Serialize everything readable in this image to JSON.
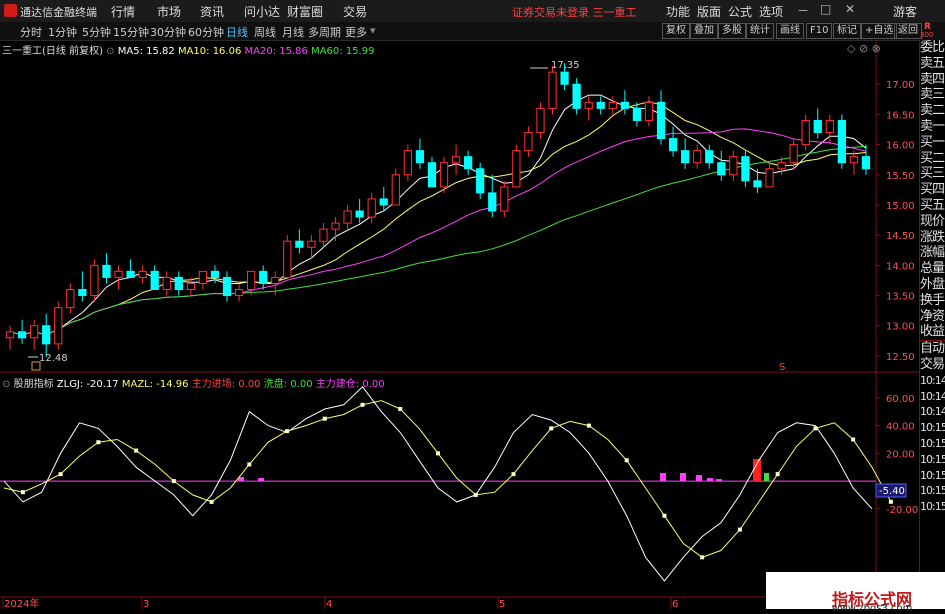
{
  "app": {
    "title": "通达信金融终端"
  },
  "menu": [
    "行情",
    "市场",
    "资讯",
    "问小达",
    "财富圈",
    "交易"
  ],
  "notice": "证券交易未登录  三一重工",
  "right_menu": [
    "功能",
    "版面",
    "公式",
    "选项"
  ],
  "user": "游客",
  "periods": [
    "分时",
    "1分钟",
    "5分钟",
    "15分钟",
    "30分钟",
    "60分钟",
    "日线",
    "周线",
    "月线",
    "多周期",
    "更多"
  ],
  "active_period": "日线",
  "toolbar_right": [
    "复权",
    "叠加",
    "多股",
    "统计",
    "画线",
    "F10",
    "标记",
    "+自选",
    "返回"
  ],
  "rank_label": "R",
  "rank_value": "300",
  "main_chart": {
    "stock_label": "三一重工(日线 前复权)",
    "ma5": "MA5: 15.82",
    "ma10": "MA10: 16.06",
    "ma20": "MA20: 15.86",
    "ma60": "MA60: 15.99",
    "high_label": "17.35",
    "low_label": "12.48",
    "y_ticks": [
      "17.00",
      "16.50",
      "16.00",
      "15.50",
      "15.00",
      "14.50",
      "14.00",
      "13.50",
      "13.00",
      "12.50"
    ],
    "s_marker": "S"
  },
  "indicator": {
    "name": "股朋指标",
    "zlgj": "ZLGJ: -20.17",
    "mazl": "MAZL: -14.96",
    "zljc": "主力进场: 0.00",
    "xp": "洗盘: 0.00",
    "zljc2": "主力建仓: 0.00",
    "y_ticks": [
      "60.00",
      "40.00",
      "20.00",
      "-20.00"
    ],
    "current_value": "-5.40"
  },
  "x_axis": [
    "2024年",
    "3",
    "4",
    "5",
    "6"
  ],
  "side_panel": [
    "委比",
    "卖五",
    "卖四",
    "卖三",
    "卖二",
    "卖一",
    "买一",
    "买二",
    "买三",
    "买四",
    "买五",
    "现价",
    "涨跌",
    "涨幅",
    "总量",
    "外盘",
    "换手",
    "净资",
    "收益",
    "自动",
    "交易",
    "10:14",
    "10:14",
    "10:14",
    "10:15",
    "10:15",
    "10:15",
    "10:15",
    "10:15",
    "10:15"
  ],
  "watermark": {
    "line1": "指标公式网",
    "line2": "www.zbgs3.com"
  },
  "colors": {
    "up": "#ff3030",
    "down": "#00ffff",
    "ma5": "#ffffff",
    "ma10": "#ffff66",
    "ma20": "#ff40ff",
    "ma60": "#40e040",
    "zero_line": "#ff40ff",
    "accent_red": "#ff4040"
  },
  "chart_data": {
    "type": "candlestick",
    "x_axis_labels": [
      "2024年",
      "3",
      "4",
      "5",
      "6"
    ],
    "candles_ohlc": [
      [
        12.8,
        13.0,
        12.6,
        12.9
      ],
      [
        12.9,
        13.1,
        12.7,
        12.8
      ],
      [
        12.8,
        13.1,
        12.6,
        13.0
      ],
      [
        13.0,
        13.2,
        12.48,
        12.7
      ],
      [
        12.7,
        13.4,
        12.6,
        13.3
      ],
      [
        13.3,
        13.7,
        13.2,
        13.6
      ],
      [
        13.6,
        13.9,
        13.4,
        13.5
      ],
      [
        13.5,
        14.1,
        13.4,
        14.0
      ],
      [
        14.0,
        14.2,
        13.7,
        13.8
      ],
      [
        13.8,
        14.0,
        13.6,
        13.9
      ],
      [
        13.9,
        14.1,
        13.8,
        13.8
      ],
      [
        13.8,
        14.0,
        13.7,
        13.9
      ],
      [
        13.9,
        14.0,
        13.6,
        13.6
      ],
      [
        13.6,
        13.9,
        13.5,
        13.8
      ],
      [
        13.8,
        13.9,
        13.5,
        13.6
      ],
      [
        13.6,
        13.8,
        13.5,
        13.7
      ],
      [
        13.7,
        13.9,
        13.6,
        13.9
      ],
      [
        13.9,
        14.0,
        13.7,
        13.8
      ],
      [
        13.8,
        13.9,
        13.4,
        13.5
      ],
      [
        13.5,
        13.7,
        13.4,
        13.6
      ],
      [
        13.6,
        13.9,
        13.5,
        13.9
      ],
      [
        13.9,
        14.0,
        13.6,
        13.7
      ],
      [
        13.7,
        13.9,
        13.5,
        13.8
      ],
      [
        13.8,
        14.5,
        13.8,
        14.4
      ],
      [
        14.4,
        14.6,
        14.2,
        14.3
      ],
      [
        14.3,
        14.5,
        14.1,
        14.4
      ],
      [
        14.4,
        14.7,
        14.3,
        14.6
      ],
      [
        14.6,
        14.8,
        14.4,
        14.7
      ],
      [
        14.7,
        15.0,
        14.6,
        14.9
      ],
      [
        14.9,
        15.1,
        14.7,
        14.8
      ],
      [
        14.8,
        15.2,
        14.7,
        15.1
      ],
      [
        15.1,
        15.3,
        14.9,
        15.0
      ],
      [
        15.0,
        15.6,
        15.0,
        15.5
      ],
      [
        15.5,
        16.0,
        15.4,
        15.9
      ],
      [
        15.9,
        16.1,
        15.6,
        15.7
      ],
      [
        15.7,
        15.8,
        15.3,
        15.3
      ],
      [
        15.3,
        15.8,
        15.2,
        15.7
      ],
      [
        15.7,
        16.0,
        15.5,
        15.8
      ],
      [
        15.8,
        15.9,
        15.5,
        15.6
      ],
      [
        15.6,
        15.7,
        15.1,
        15.2
      ],
      [
        15.2,
        15.5,
        14.8,
        14.9
      ],
      [
        14.9,
        15.4,
        14.8,
        15.3
      ],
      [
        15.3,
        16.0,
        15.3,
        15.9
      ],
      [
        15.9,
        16.3,
        15.8,
        16.2
      ],
      [
        16.2,
        16.7,
        16.1,
        16.6
      ],
      [
        16.6,
        17.3,
        16.5,
        17.2
      ],
      [
        17.2,
        17.35,
        16.9,
        17.0
      ],
      [
        17.0,
        17.1,
        16.5,
        16.6
      ],
      [
        16.6,
        16.8,
        16.4,
        16.7
      ],
      [
        16.7,
        16.8,
        16.5,
        16.6
      ],
      [
        16.6,
        16.8,
        16.5,
        16.7
      ],
      [
        16.7,
        16.9,
        16.5,
        16.6
      ],
      [
        16.6,
        16.7,
        16.3,
        16.4
      ],
      [
        16.4,
        16.8,
        16.3,
        16.7
      ],
      [
        16.7,
        16.9,
        16.0,
        16.1
      ],
      [
        16.1,
        16.3,
        15.8,
        15.9
      ],
      [
        15.9,
        16.1,
        15.6,
        15.7
      ],
      [
        15.7,
        16.0,
        15.6,
        15.9
      ],
      [
        15.9,
        16.0,
        15.6,
        15.7
      ],
      [
        15.7,
        15.9,
        15.4,
        15.5
      ],
      [
        15.5,
        15.9,
        15.4,
        15.8
      ],
      [
        15.8,
        15.9,
        15.3,
        15.4
      ],
      [
        15.4,
        15.6,
        15.2,
        15.3
      ],
      [
        15.3,
        15.7,
        15.3,
        15.6
      ],
      [
        15.6,
        15.8,
        15.5,
        15.7
      ],
      [
        15.7,
        16.1,
        15.6,
        16.0
      ],
      [
        16.0,
        16.5,
        15.9,
        16.4
      ],
      [
        16.4,
        16.6,
        16.1,
        16.2
      ],
      [
        16.2,
        16.5,
        16.0,
        16.4
      ],
      [
        16.4,
        16.5,
        15.6,
        15.7
      ],
      [
        15.7,
        15.9,
        15.5,
        15.8
      ],
      [
        15.8,
        16.0,
        15.5,
        15.6
      ]
    ],
    "y_range": [
      12.3,
      17.6
    ],
    "indicator_series": {
      "ZLGJ": [
        0,
        -15,
        -8,
        20,
        42,
        38,
        25,
        10,
        0,
        -10,
        -25,
        -10,
        15,
        50,
        40,
        35,
        45,
        52,
        55,
        68,
        50,
        35,
        15,
        -5,
        -15,
        -10,
        10,
        35,
        48,
        44,
        35,
        20,
        0,
        -25,
        -55,
        -72,
        -55,
        -40,
        -30,
        -10,
        15,
        35,
        42,
        40,
        20,
        -5,
        -20
      ],
      "MAZL": [
        -5,
        -8,
        -2,
        5,
        18,
        28,
        30,
        22,
        12,
        0,
        -10,
        -15,
        -5,
        12,
        28,
        36,
        40,
        45,
        48,
        55,
        58,
        52,
        38,
        20,
        2,
        -10,
        -8,
        5,
        22,
        38,
        43,
        40,
        30,
        15,
        -5,
        -25,
        -45,
        -55,
        -50,
        -35,
        -15,
        5,
        25,
        38,
        42,
        30,
        10,
        -14.96
      ]
    },
    "indicator_y_range": [
      -80,
      70
    ]
  }
}
